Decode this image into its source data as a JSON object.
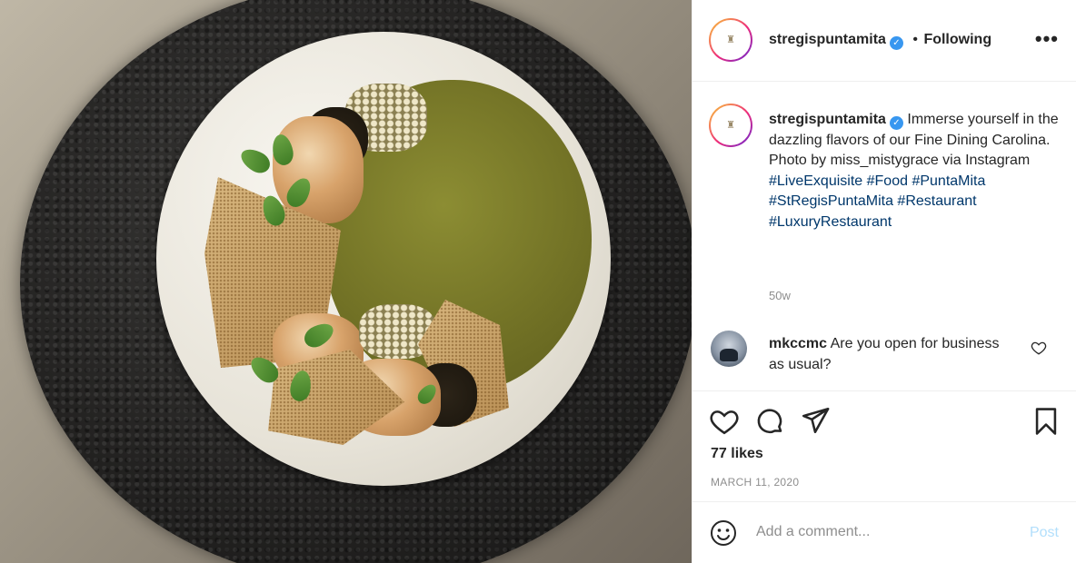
{
  "post": {
    "image_alt": "Plated dish with green soup, prawns and crisps",
    "account": {
      "username": "stregispuntamita",
      "verified_mark": "✓",
      "separator": "•",
      "follow_status": "Following",
      "more_options": "•••",
      "logo_glyph": "♜"
    },
    "caption": {
      "username": "stregispuntamita",
      "line1": "Immerse yourself in the dazzling flavors of our Fine Dining Carolina.",
      "line2": "Photo by miss_mistygrace via Instagram",
      "hashtags": [
        "#LiveExquisite",
        "#Food",
        "#PuntaMita",
        "#StRegisPuntaMita",
        "#Restaurant",
        "#LuxuryRestaurant"
      ],
      "time_ago": "50w"
    },
    "comments": [
      {
        "username": "mkccmc",
        "text": "Are you open for business as usual?"
      }
    ],
    "likes_label": "77 likes",
    "date": "MARCH 11, 2020",
    "add_comment": {
      "placeholder": "Add a comment...",
      "post_label": "Post"
    },
    "icons": {
      "like": "heart-icon",
      "comment": "comment-bubble-icon",
      "share": "paper-plane-icon",
      "save": "bookmark-icon",
      "emoji": "emoji-icon"
    },
    "colors": {
      "link": "#00376b",
      "verified": "#3897f0",
      "post_disabled": "#b2dffc",
      "muted": "#8e8e8e"
    }
  }
}
